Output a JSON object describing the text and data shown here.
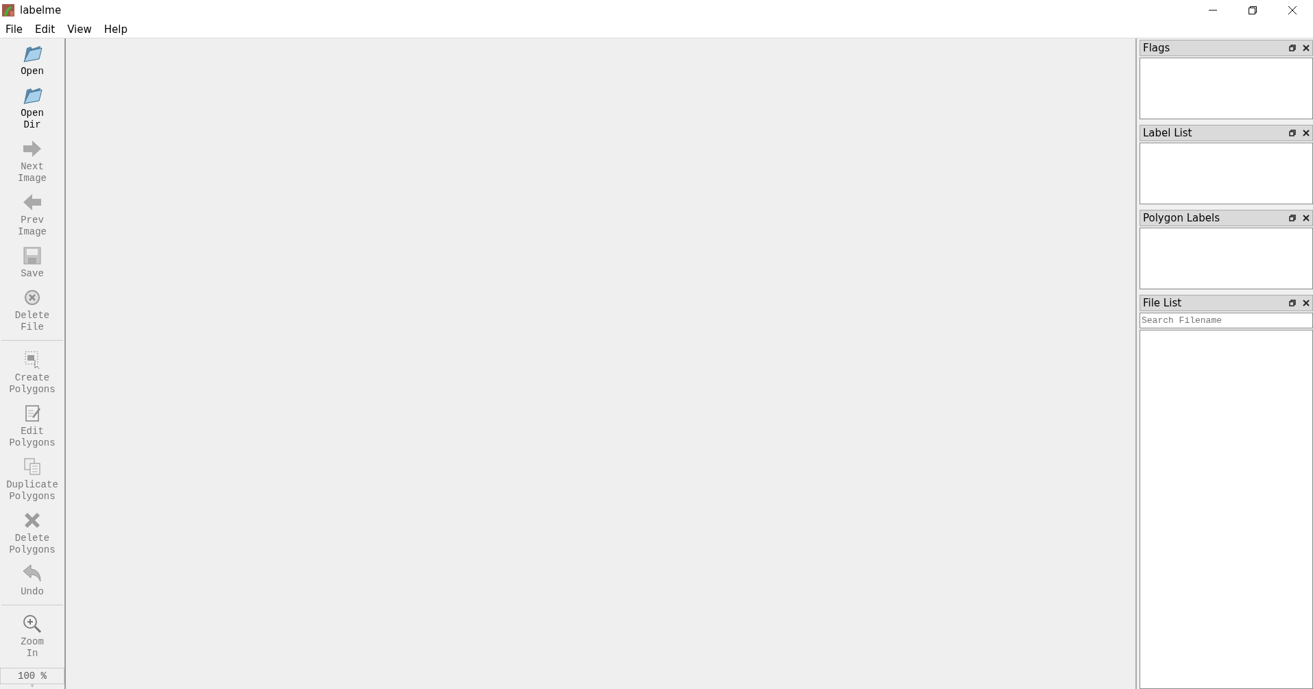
{
  "window": {
    "title": "labelme"
  },
  "menu": [
    "File",
    "Edit",
    "View",
    "Help"
  ],
  "toolbar": {
    "groups": [
      [
        {
          "kind": "folder",
          "label": "Open",
          "disabled": false
        },
        {
          "kind": "folder",
          "label": "Open Dir",
          "disabled": false
        },
        {
          "kind": "next",
          "label": "Next Image",
          "disabled": true
        },
        {
          "kind": "prev",
          "label": "Prev Image",
          "disabled": true
        },
        {
          "kind": "save",
          "label": "Save",
          "disabled": true
        },
        {
          "kind": "delete",
          "label": "Delete File",
          "disabled": true
        }
      ],
      [
        {
          "kind": "create",
          "label": "Create Polygons",
          "disabled": true
        },
        {
          "kind": "edit",
          "label": "Edit Polygons",
          "disabled": true
        },
        {
          "kind": "duplicate",
          "label": "Duplicate Polygons",
          "disabled": true
        },
        {
          "kind": "cross",
          "label": "Delete Polygons",
          "disabled": true
        },
        {
          "kind": "undo",
          "label": "Undo",
          "disabled": true
        }
      ],
      [
        {
          "kind": "zoom",
          "label": "Zoom In",
          "disabled": true
        }
      ]
    ],
    "zoom_value": "100 %"
  },
  "docks": [
    {
      "title": "Flags"
    },
    {
      "title": "Label List"
    },
    {
      "title": "Polygon Labels"
    },
    {
      "title": "File List",
      "search": {
        "placeholder": "Search Filename"
      }
    }
  ]
}
